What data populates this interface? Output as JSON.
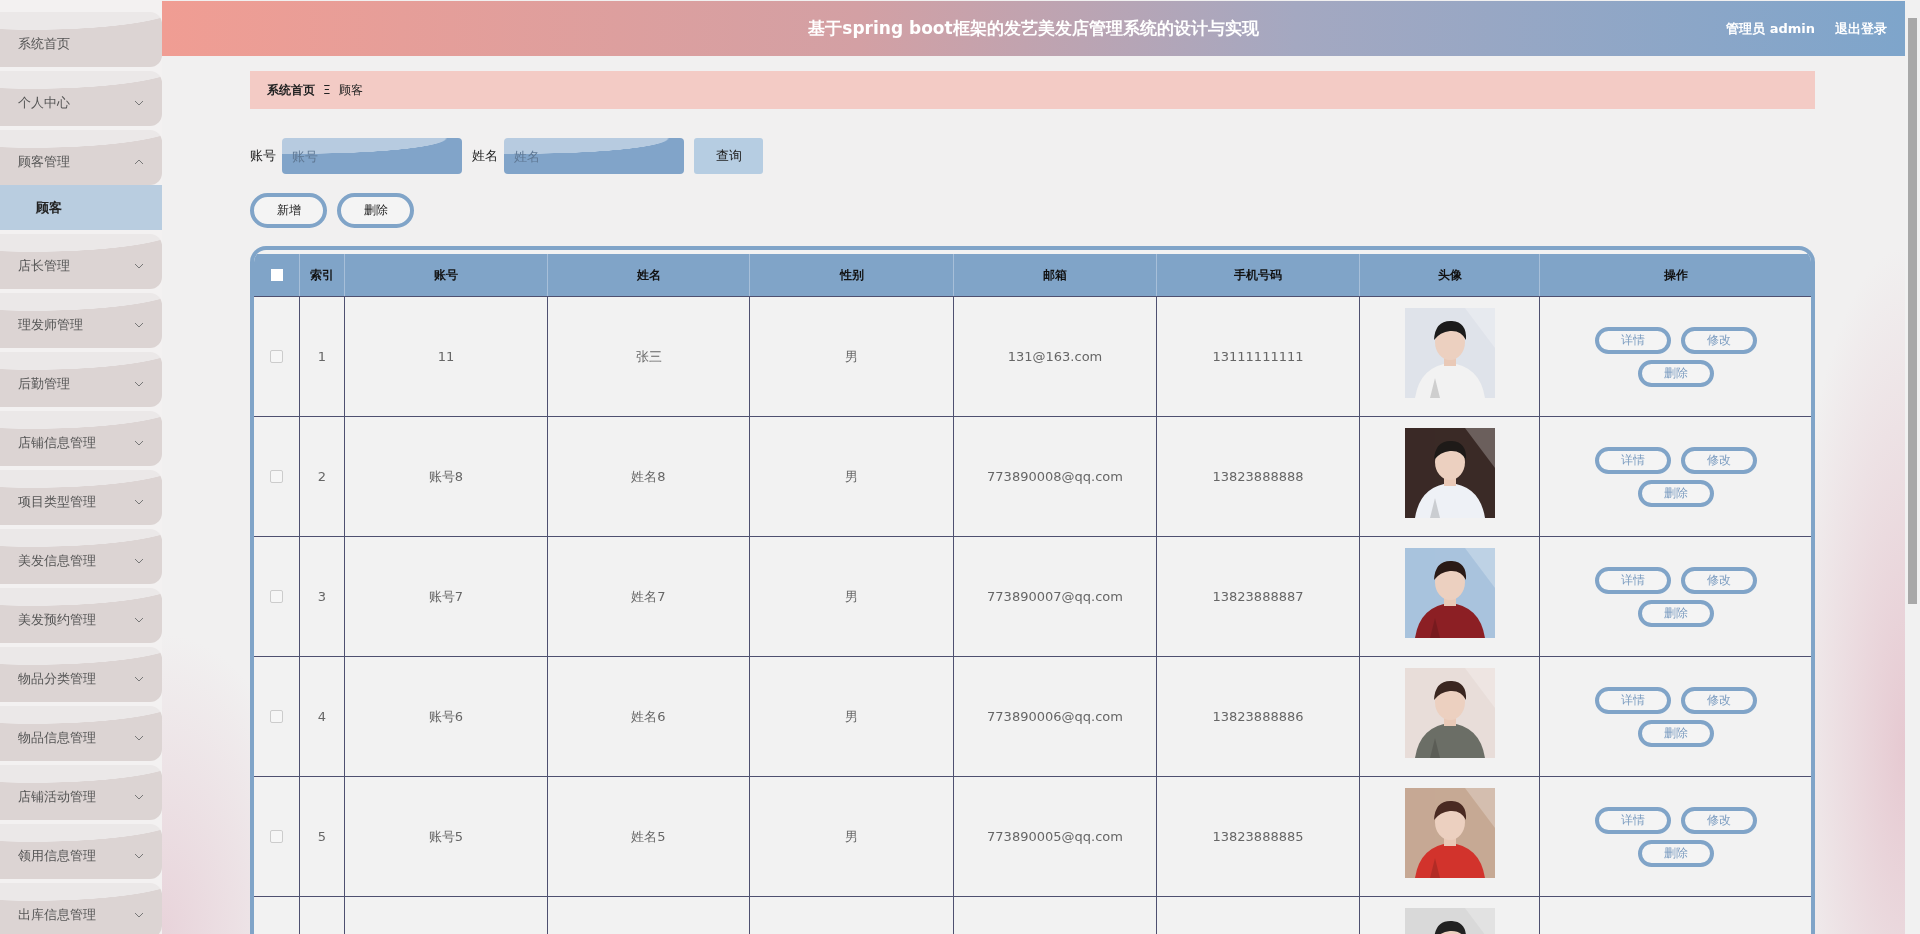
{
  "sidebar": {
    "items": [
      {
        "label": "系统首页",
        "kind": "link"
      },
      {
        "label": "个人中心",
        "kind": "menu",
        "expanded": false
      },
      {
        "label": "顾客管理",
        "kind": "menu",
        "expanded": true,
        "children": [
          {
            "label": "顾客",
            "selected": true
          }
        ]
      },
      {
        "label": "店长管理",
        "kind": "menu",
        "expanded": false
      },
      {
        "label": "理发师管理",
        "kind": "menu",
        "expanded": false
      },
      {
        "label": "后勤管理",
        "kind": "menu",
        "expanded": false
      },
      {
        "label": "店铺信息管理",
        "kind": "menu",
        "expanded": false
      },
      {
        "label": "项目类型管理",
        "kind": "menu",
        "expanded": false
      },
      {
        "label": "美发信息管理",
        "kind": "menu",
        "expanded": false
      },
      {
        "label": "美发预约管理",
        "kind": "menu",
        "expanded": false
      },
      {
        "label": "物品分类管理",
        "kind": "menu",
        "expanded": false
      },
      {
        "label": "物品信息管理",
        "kind": "menu",
        "expanded": false
      },
      {
        "label": "店铺活动管理",
        "kind": "menu",
        "expanded": false
      },
      {
        "label": "领用信息管理",
        "kind": "menu",
        "expanded": false
      },
      {
        "label": "出库信息管理",
        "kind": "menu",
        "expanded": false
      }
    ]
  },
  "header": {
    "title": "基于spring boot框架的发艺美发店管理系统的设计与实现",
    "user": "管理员 admin",
    "logout": "退出登录"
  },
  "breadcrumb": {
    "items": [
      "系统首页",
      "顾客"
    ],
    "separator": "Ξ"
  },
  "search": {
    "fields": [
      {
        "label": "账号",
        "placeholder": "账号"
      },
      {
        "label": "姓名",
        "placeholder": "姓名"
      }
    ],
    "button": "查询"
  },
  "actions": [
    "新增",
    "删除"
  ],
  "table": {
    "select_all": {
      "checked": false
    },
    "columns": [
      "索引",
      "账号",
      "姓名",
      "性别",
      "邮箱",
      "手机号码",
      "头像",
      "操作"
    ],
    "rows": [
      {
        "checked": false,
        "index": "1",
        "account": "11",
        "name": "张三",
        "gender": "男",
        "email": "131@163.com",
        "phone": "13111111111",
        "avatar": {
          "kind": "picture"
        },
        "buttons": [
          "详情",
          "修改",
          "删除"
        ]
      },
      {
        "checked": false,
        "index": "2",
        "account": "账号8",
        "name": "姓名8",
        "gender": "男",
        "email": "773890008@qq.com",
        "phone": "13823888888",
        "avatar": {
          "kind": "picture"
        },
        "buttons": [
          "详情",
          "修改",
          "删除"
        ]
      },
      {
        "checked": false,
        "index": "3",
        "account": "账号7",
        "name": "姓名7",
        "gender": "男",
        "email": "773890007@qq.com",
        "phone": "13823888887",
        "avatar": {
          "kind": "picture"
        },
        "buttons": [
          "详情",
          "修改",
          "删除"
        ]
      },
      {
        "checked": false,
        "index": "4",
        "account": "账号6",
        "name": "姓名6",
        "gender": "男",
        "email": "773890006@qq.com",
        "phone": "13823888886",
        "avatar": {
          "kind": "picture"
        },
        "buttons": [
          "详情",
          "修改",
          "删除"
        ]
      },
      {
        "checked": false,
        "index": "5",
        "account": "账号5",
        "name": "姓名5",
        "gender": "男",
        "email": "773890005@qq.com",
        "phone": "13823888885",
        "avatar": {
          "kind": "picture"
        },
        "buttons": [
          "详情",
          "修改",
          "删除"
        ]
      },
      {
        "avatar": {
          "kind": "picture"
        }
      }
    ]
  }
}
